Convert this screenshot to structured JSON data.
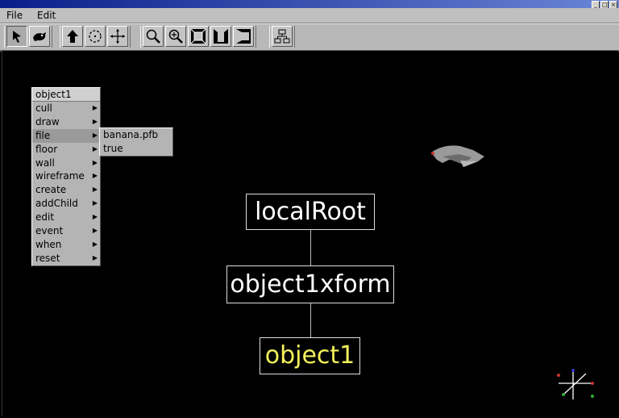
{
  "window": {
    "controls": [
      "_",
      "□",
      "×"
    ]
  },
  "menubar": {
    "items": [
      "File",
      "Edit"
    ]
  },
  "toolbar": {
    "groups": [
      [
        "select-arrow-icon",
        "fly-icon"
      ],
      [
        "up-arrow-icon",
        "rotate-icon",
        "pan-icon"
      ],
      [
        "zoom-icon",
        "zoom-in-icon",
        "view-front-icon",
        "view-perspective-icon",
        "view-side-icon"
      ],
      [
        "scene-graph-icon"
      ]
    ]
  },
  "context_menu": {
    "title": "object1",
    "items": [
      "cull",
      "draw",
      "file",
      "floor",
      "wall",
      "wireframe",
      "create",
      "addChild",
      "edit",
      "event",
      "when",
      "reset"
    ],
    "active_item": "file"
  },
  "submenu": {
    "items": [
      "banana.pfb",
      "true"
    ]
  },
  "scene_graph": {
    "nodes": [
      "localRoot",
      "object1xform",
      "object1"
    ],
    "selected": "object1",
    "selected_color": "#f2f05a"
  },
  "colors": {
    "background": "#000000",
    "titlebar": "#0a1e8a",
    "panel": "#c0c0c0"
  }
}
